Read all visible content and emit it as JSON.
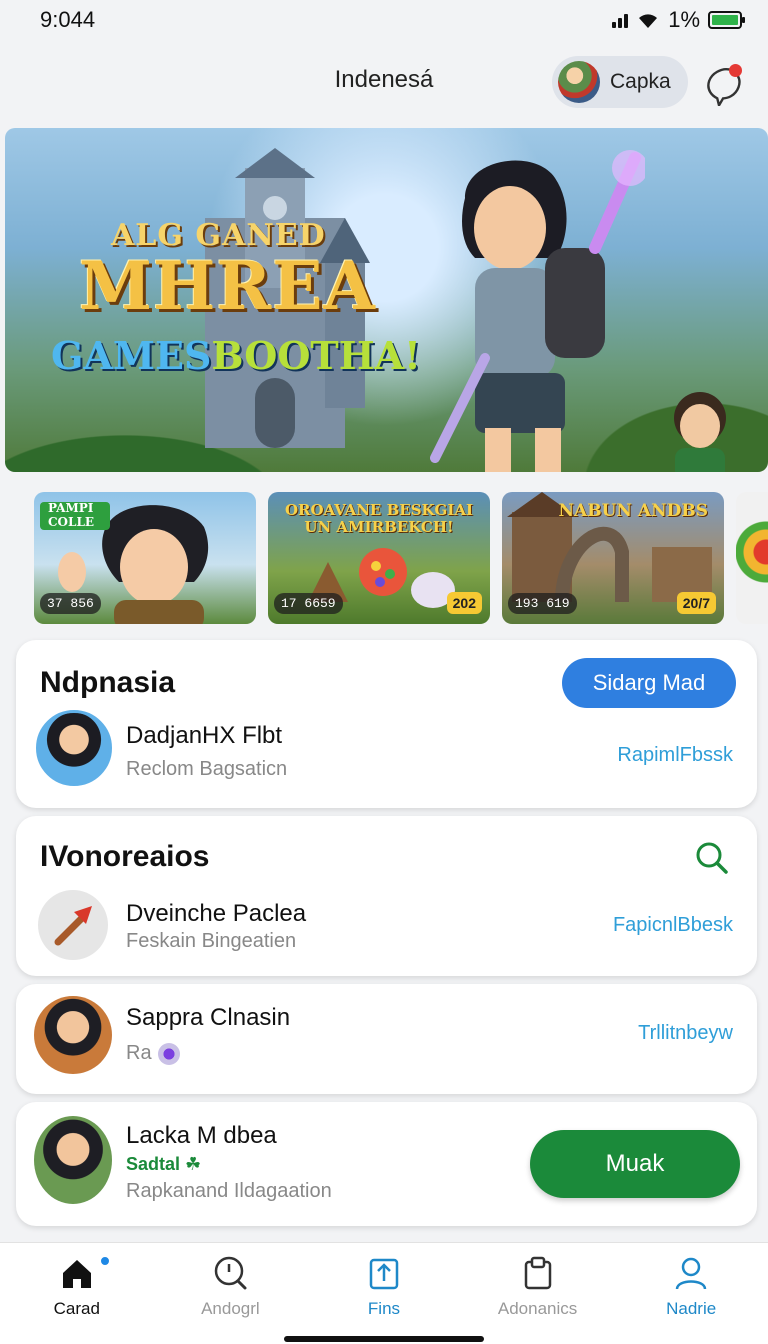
{
  "status_bar": {
    "time": "9:044",
    "battery": "1%"
  },
  "header": {
    "title": "Indenesá",
    "account_label": "Capka"
  },
  "hero": {
    "kicker": "ALG GANED",
    "title": "MHREA",
    "subtitle_a": "GAMES",
    "subtitle_b": "BOOTHA!"
  },
  "thumbnails": [
    {
      "title": "PAMPI COLLE",
      "count": "37 856",
      "year": ""
    },
    {
      "title": "OROAVANE BESKGIAI UN AMIRBEKCH!",
      "count": "17 6659",
      "year": "202"
    },
    {
      "title": "NABUN ANDBS",
      "count": "193 619",
      "year": "20/7"
    },
    {
      "title": "",
      "count": "",
      "year": ""
    }
  ],
  "card1": {
    "heading": "Ndpnasia",
    "button_label": "Sidarg Mad",
    "row": {
      "name": "DadjanHX Flbt",
      "sub": "Reclom Bagsaticn",
      "link": "RapimlFbssk"
    }
  },
  "card2": {
    "heading": "IVonoreaios",
    "row": {
      "name": "Dveinche Paclea",
      "sub": "Feskain Bingeatien",
      "link": "FapicnlBbesk"
    }
  },
  "card3": {
    "row": {
      "name": "Sappra Clnasin",
      "sub": "Ra",
      "link": "Trllitnbeyw"
    }
  },
  "card4": {
    "row": {
      "name": "Lacka M dbea",
      "tag": "Sadtal",
      "sub": "Rapkanand Ildagaation"
    },
    "button_label": "Muak"
  },
  "bottom_nav": [
    {
      "label": "Carad",
      "icon": "home-icon"
    },
    {
      "label": "Andogrl",
      "icon": "search-icon"
    },
    {
      "label": "Fins",
      "icon": "upload-icon"
    },
    {
      "label": "Adonanics",
      "icon": "clipboard-icon"
    },
    {
      "label": "Nadrie",
      "icon": "profile-icon"
    }
  ],
  "colors": {
    "primary_blue": "#2f7fe0",
    "primary_green": "#1b8a3a",
    "link": "#2f9ed8",
    "accent_nav": "#1e88c8"
  }
}
